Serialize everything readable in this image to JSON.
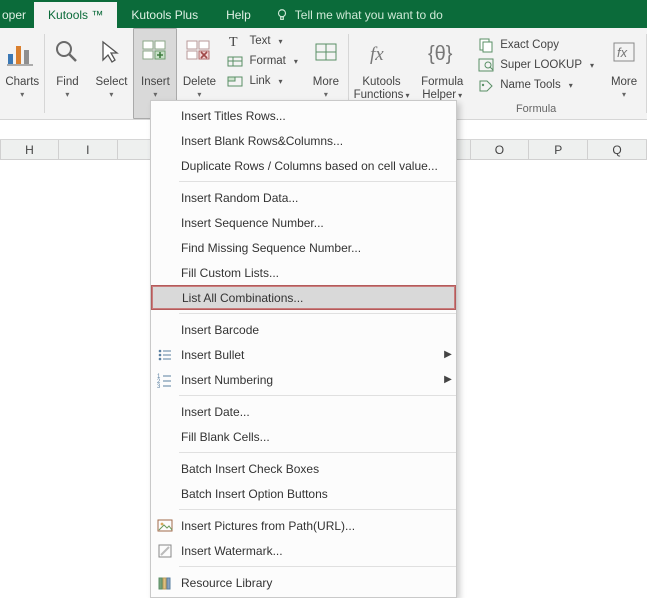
{
  "tabs": {
    "left_partial": "oper",
    "active": "Kutools ™",
    "t2": "Kutools Plus",
    "t3": "Help",
    "tellme": "Tell me what you want to do"
  },
  "ribbon": {
    "charts": "Charts",
    "find": "Find",
    "select": "Select",
    "insert": "Insert",
    "delete": "Delete",
    "text": "Text",
    "format": "Format",
    "link": "Link",
    "more1": "More",
    "kfuncs": "Kutools\nFunctions",
    "fhelper": "Formula\nHelper",
    "exactcopy": "Exact Copy",
    "slookup": "Super LOOKUP",
    "nametools": "Name Tools",
    "more2": "More",
    "grp_formula": "Formula"
  },
  "cols": [
    "H",
    "I",
    "",
    "",
    "",
    "",
    "",
    "",
    "O",
    "P",
    "Q"
  ],
  "menu": {
    "i0": "Insert Titles Rows...",
    "i1": "Insert Blank Rows&Columns...",
    "i2": "Duplicate Rows / Columns based on cell value...",
    "i3": "Insert Random Data...",
    "i4": "Insert Sequence Number...",
    "i5": "Find Missing Sequence Number...",
    "i6": "Fill Custom Lists...",
    "i7": "List All Combinations...",
    "i8": "Insert Barcode",
    "i9": "Insert Bullet",
    "i10": "Insert Numbering",
    "i11": "Insert Date...",
    "i12": "Fill Blank Cells...",
    "i13": "Batch Insert Check Boxes",
    "i14": "Batch Insert Option Buttons",
    "i15": "Insert Pictures from Path(URL)...",
    "i16": "Insert Watermark...",
    "i17": "Resource Library"
  }
}
